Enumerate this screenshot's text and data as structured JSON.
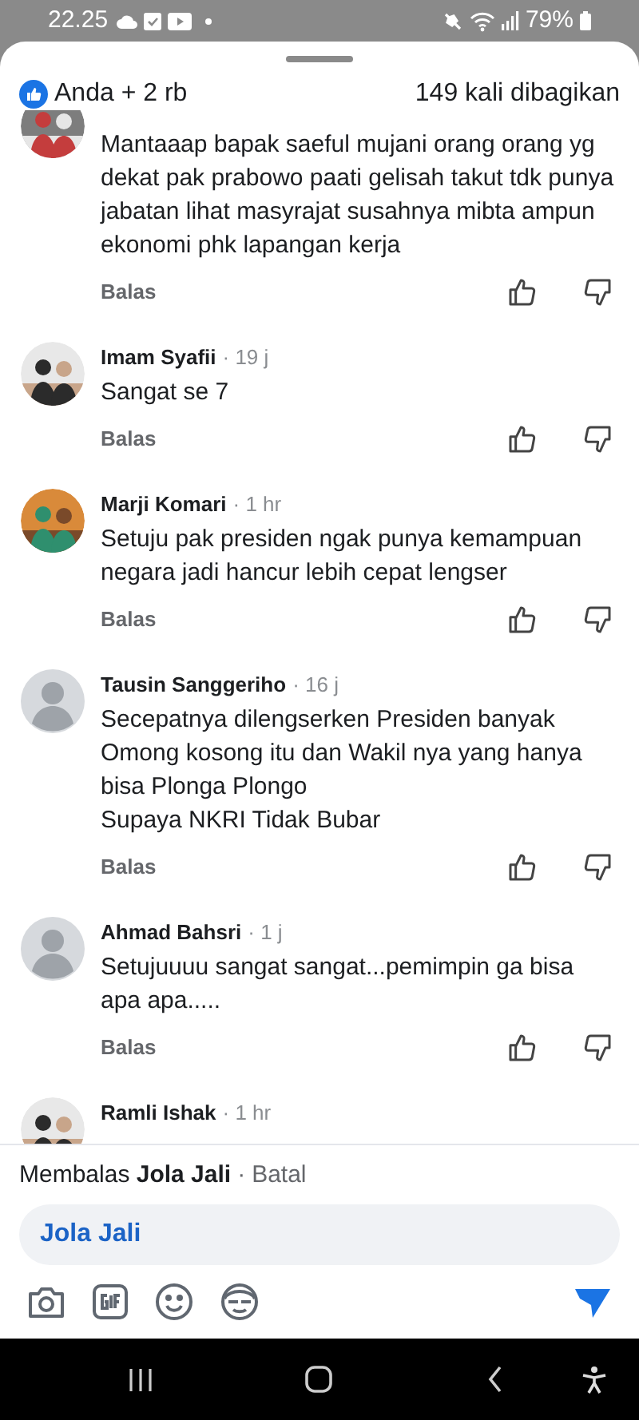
{
  "status_bar": {
    "time": "22.25",
    "battery": "79%"
  },
  "header": {
    "reactions": "Anda + 2 rb",
    "shares": "149 kali dibagikan"
  },
  "comments": [
    {
      "text": "Mantaaap bapak saeful mujani orang orang yg dekat pak prabowo paati gelisah takut tdk punya jabatan lihat masyrajat susahnya mibta ampun ekonomi phk lapangan kerja",
      "reply": "Balas"
    },
    {
      "name": "Imam Syafii",
      "time": "· 19 j",
      "text": "Sangat se 7",
      "reply": "Balas"
    },
    {
      "name": "Marji Komari",
      "time": "· 1 hr",
      "text": "Setuju pak presiden ngak punya kemampuan negara jadi hancur lebih cepat lengser",
      "reply": "Balas"
    },
    {
      "name": "Tausin Sanggeriho",
      "time": "· 16 j",
      "avatar": {
        "kind": "default"
      },
      "text": "Secepatnya dilengserken Presiden banyak Omong kosong itu dan Wakil nya yang hanya bisa Plonga Plongo\nSupaya NKRI Tidak Bubar",
      "reply": "Balas"
    },
    {
      "name": "Ahmad Bahsri",
      "time": "· 1 j",
      "avatar": {
        "kind": "default"
      },
      "text": "Setujuuuu sangat sangat...pemimpin ga bisa apa apa.....",
      "reply": "Balas"
    },
    {
      "name": "Ramli Ishak",
      "time": "· 1 hr"
    }
  ],
  "reply_bar": {
    "prefix": "Membalas",
    "target": "Jola Jali",
    "separator": "·",
    "cancel": "Batal",
    "input_value": "Jola Jali"
  }
}
